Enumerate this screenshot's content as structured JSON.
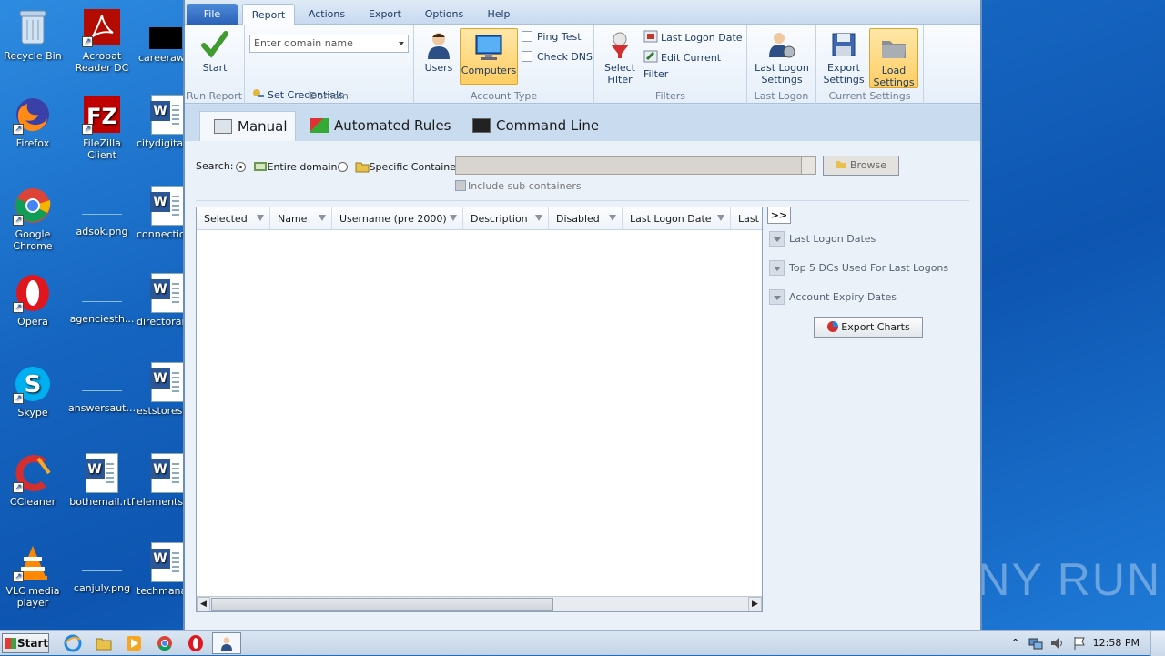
{
  "desktop": {
    "icons": [
      {
        "label": "Recycle Bin",
        "icon": "recycle-bin-icon"
      },
      {
        "label": "Acrobat Reader DC",
        "icon": "acrobat-icon"
      },
      {
        "label": "careerawa",
        "icon": "file-icon"
      },
      {
        "label": "Firefox",
        "icon": "firefox-icon"
      },
      {
        "label": "FileZilla Client",
        "icon": "filezilla-icon"
      },
      {
        "label": "citydigital",
        "icon": "word-doc-icon"
      },
      {
        "label": "Google Chrome",
        "icon": "chrome-icon"
      },
      {
        "label": "adsok.png",
        "icon": "image-icon"
      },
      {
        "label": "connectio",
        "icon": "word-doc-icon"
      },
      {
        "label": "Opera",
        "icon": "opera-icon"
      },
      {
        "label": "agenciesth...",
        "icon": "image-icon"
      },
      {
        "label": "directorar",
        "icon": "word-doc-icon"
      },
      {
        "label": "Skype",
        "icon": "skype-icon"
      },
      {
        "label": "answersaut...",
        "icon": "image-icon"
      },
      {
        "label": "eststores",
        "icon": "word-doc-icon"
      },
      {
        "label": "CCleaner",
        "icon": "ccleaner-icon"
      },
      {
        "label": "bothemail.rtf",
        "icon": "word-doc-icon"
      },
      {
        "label": "elementsp",
        "icon": "word-doc-icon"
      },
      {
        "label": "VLC media player",
        "icon": "vlc-icon"
      },
      {
        "label": "canjuly.png",
        "icon": "image-icon"
      },
      {
        "label": "techmana",
        "icon": "word-doc-icon"
      }
    ],
    "watermark": "ANY RUN"
  },
  "menu": {
    "file": "File",
    "report": "Report",
    "actions": "Actions",
    "export": "Export",
    "options": "Options",
    "help": "Help"
  },
  "ribbon": {
    "start": "Start",
    "run_report": "Run Report",
    "domain_placeholder": "Enter domain name",
    "set_credentials": "Set Credentials",
    "domain": "Domain",
    "users": "Users",
    "computers": "Computers",
    "ping_test": "Ping Test",
    "check_dns": "Check DNS",
    "account_type": "Account Type",
    "select_filter_1": "Select",
    "select_filter_2": "Filter",
    "last_logon_date": "Last Logon Date",
    "edit_current_filter": "Edit Current Filter",
    "filters": "Filters",
    "last_logon_settings_1": "Last Logon",
    "last_logon_settings_2": "Settings",
    "last_logon": "Last Logon",
    "export_settings_1": "Export",
    "export_settings_2": "Settings",
    "load_settings_1": "Load",
    "load_settings_2": "Settings",
    "current_settings": "Current Settings"
  },
  "tabs": {
    "manual": "Manual",
    "automated": "Automated Rules",
    "command": "Command Line"
  },
  "search": {
    "label": "Search:",
    "entire_domain": "Entire domain",
    "specific_container": "Specific Container:",
    "browse": "Browse",
    "include_sub": "Include sub containers"
  },
  "grid": {
    "columns": [
      "Selected",
      "Name",
      "Username (pre 2000)",
      "Description",
      "Disabled",
      "Last Logon Date",
      "Last L"
    ],
    "expand": ">>"
  },
  "side": {
    "last_logon_dates": "Last Logon Dates",
    "top5": "Top 5 DCs Used For Last Logons",
    "account_expiry": "Account Expiry Dates",
    "export_charts": "Export Charts"
  },
  "taskbar": {
    "start": "Start",
    "clock": "12:58 PM"
  }
}
